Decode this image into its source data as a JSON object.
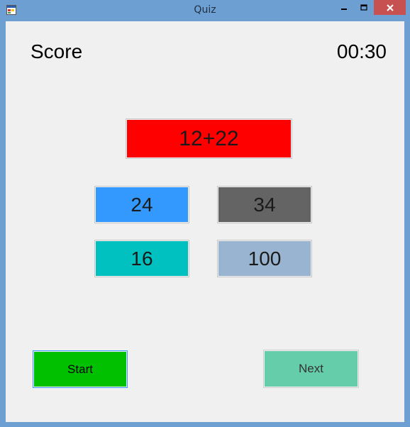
{
  "window": {
    "title": "Quiz",
    "icon": "winforms-app-icon",
    "controls": {
      "minimize": "minimize-icon",
      "maximize": "maximize-icon",
      "close": "close-icon"
    },
    "close_color": "#c75050"
  },
  "header": {
    "score_label": "Score",
    "timer": "00:30"
  },
  "question": {
    "text": "12+22",
    "color": "#ff0000"
  },
  "answers": [
    {
      "label": "24",
      "color": "#3399ff"
    },
    {
      "label": "34",
      "color": "#646464"
    },
    {
      "label": "16",
      "color": "#00c0c0"
    },
    {
      "label": "100",
      "color": "#99b4d1"
    }
  ],
  "buttons": {
    "start_label": "Start",
    "start_color": "#00c000",
    "next_label": "Next",
    "next_color": "#66cdaa"
  }
}
